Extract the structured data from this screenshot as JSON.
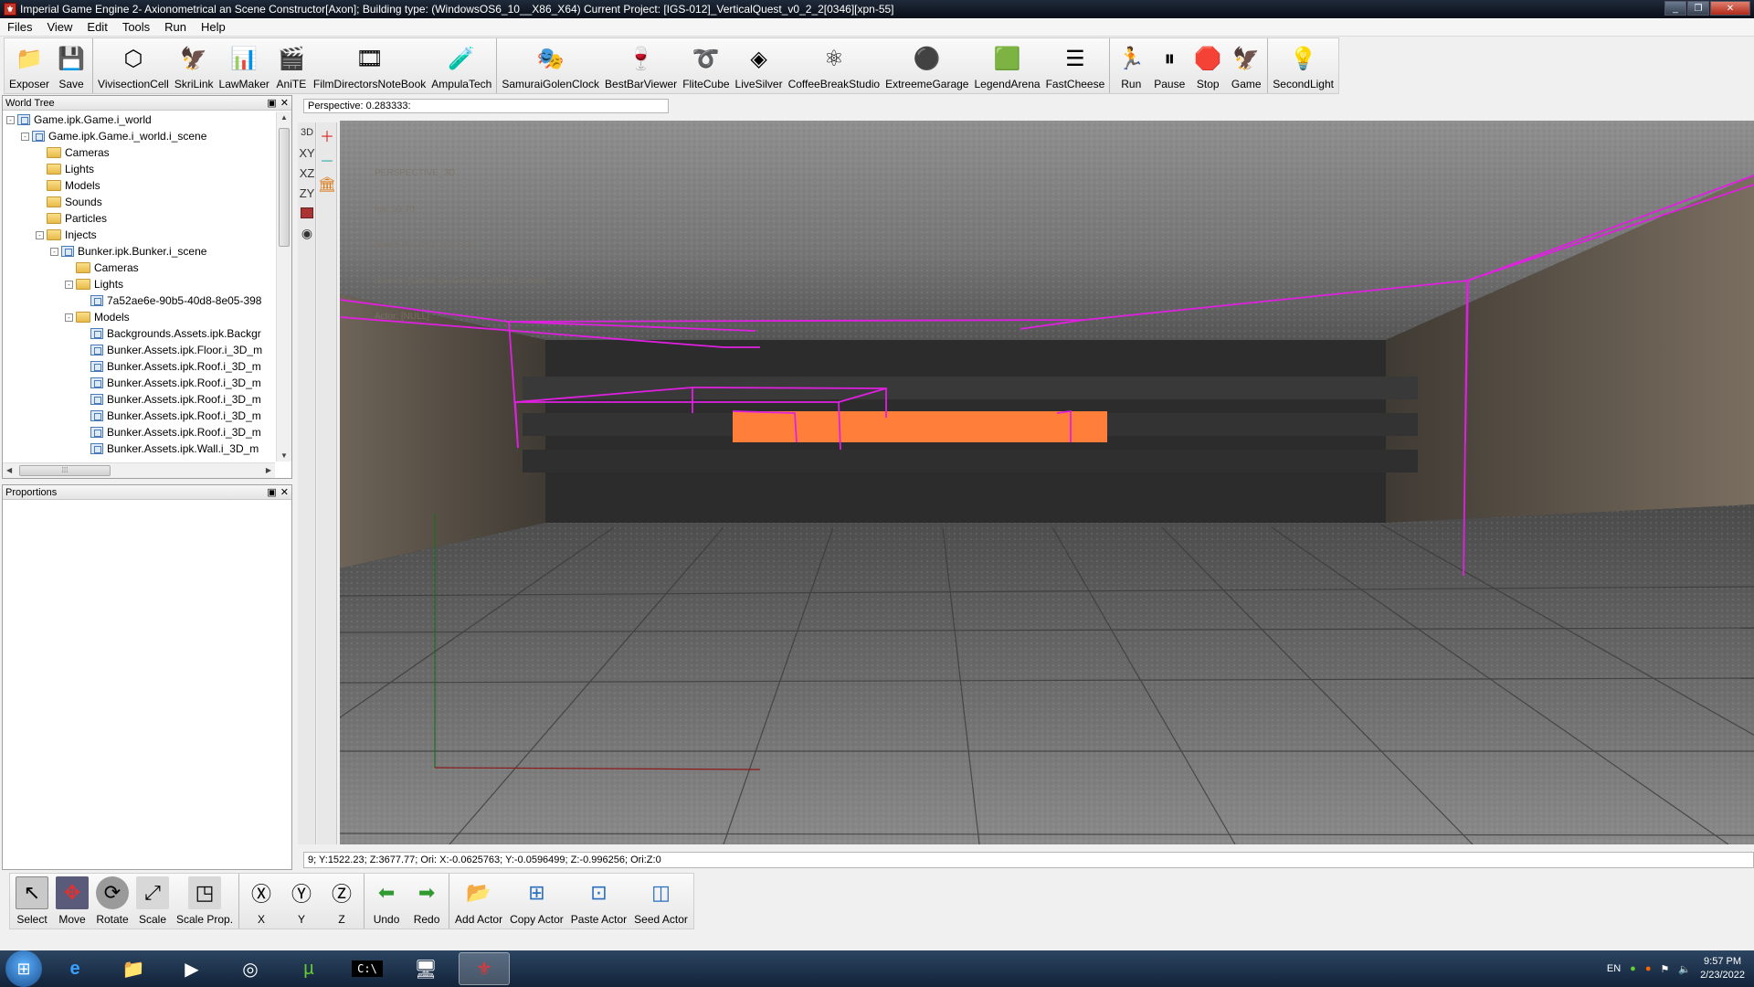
{
  "window": {
    "title": "Imperial Game Engine 2- Axionometrical an Scene Constructor[Axon]; Building type: (WindowsOS6_10__X86_X64) Current Project: [IGS-012]_VerticalQuest_v0_2_2[0346][xpn-55]",
    "buttons": [
      "_",
      "❐",
      "✕"
    ]
  },
  "menu": [
    "Files",
    "View",
    "Edit",
    "Tools",
    "Run",
    "Help"
  ],
  "toolbar": [
    {
      "label": "Exposer",
      "icon": "exposer-icon",
      "glyph": "📁"
    },
    {
      "label": "Save",
      "icon": "save-icon",
      "glyph": "💾"
    },
    {
      "label": "VivisectionCell",
      "icon": "cube-icon",
      "glyph": "⬡"
    },
    {
      "label": "SkriLink",
      "icon": "eagle-icon",
      "glyph": "🦅"
    },
    {
      "label": "LawMaker",
      "icon": "chart-icon",
      "glyph": "📊"
    },
    {
      "label": "AniTE",
      "icon": "clapper-icon",
      "glyph": "🎬"
    },
    {
      "label": "FilmDirectorsNoteBook",
      "icon": "notebook-icon",
      "glyph": "🎞"
    },
    {
      "label": "AmpulaTech",
      "icon": "ampule-icon",
      "glyph": "🧪"
    },
    {
      "label": "SamuraiGolenClock",
      "icon": "masks-icon",
      "glyph": "🎭"
    },
    {
      "label": "BestBarViewer",
      "icon": "bar-icon",
      "glyph": "🍷"
    },
    {
      "label": "FliteCube",
      "icon": "loop-icon",
      "glyph": "➰"
    },
    {
      "label": "LiveSilver",
      "icon": "diamond-icon",
      "glyph": "◈"
    },
    {
      "label": "CoffeeBreakStudio",
      "icon": "atom-icon",
      "glyph": "⚛"
    },
    {
      "label": "ExtreemeGarage",
      "icon": "dots-icon",
      "glyph": "⚫"
    },
    {
      "label": "LegendArena",
      "icon": "arena-icon",
      "glyph": "🟩"
    },
    {
      "label": "FastCheese",
      "icon": "sliders-icon",
      "glyph": "☰"
    },
    {
      "label": "Run",
      "icon": "run-icon",
      "glyph": "🏃"
    },
    {
      "label": "Pause",
      "icon": "pause-icon",
      "glyph": "⏸"
    },
    {
      "label": "Stop",
      "icon": "stop-icon",
      "glyph": "🛑"
    },
    {
      "label": "Game",
      "icon": "game-icon",
      "glyph": "🦅"
    },
    {
      "label": "SecondLight",
      "icon": "light-icon",
      "glyph": "💡"
    }
  ],
  "world_tree": {
    "title": "World Tree",
    "items": [
      {
        "label": "Game.ipk.Game.i_world",
        "indent": 0,
        "type": "node",
        "exp": "-"
      },
      {
        "label": "Game.ipk.Game.i_world.i_scene",
        "indent": 1,
        "type": "node",
        "exp": "-"
      },
      {
        "label": "Cameras",
        "indent": 2,
        "type": "folder",
        "exp": ""
      },
      {
        "label": "Lights",
        "indent": 2,
        "type": "folder",
        "exp": ""
      },
      {
        "label": "Models",
        "indent": 2,
        "type": "folder",
        "exp": ""
      },
      {
        "label": "Sounds",
        "indent": 2,
        "type": "folder",
        "exp": ""
      },
      {
        "label": "Particles",
        "indent": 2,
        "type": "folder",
        "exp": ""
      },
      {
        "label": "Injects",
        "indent": 2,
        "type": "folder",
        "exp": "-"
      },
      {
        "label": "Bunker.ipk.Bunker.i_scene",
        "indent": 3,
        "type": "node",
        "exp": "-"
      },
      {
        "label": "Cameras",
        "indent": 4,
        "type": "folder",
        "exp": ""
      },
      {
        "label": "Lights",
        "indent": 4,
        "type": "folder",
        "exp": "-"
      },
      {
        "label": "7a52ae6e-90b5-40d8-8e05-398",
        "indent": 5,
        "type": "node",
        "exp": ""
      },
      {
        "label": "Models",
        "indent": 4,
        "type": "folder",
        "exp": "-"
      },
      {
        "label": "Backgrounds.Assets.ipk.Backgr",
        "indent": 5,
        "type": "node",
        "exp": ""
      },
      {
        "label": "Bunker.Assets.ipk.Floor.i_3D_m",
        "indent": 5,
        "type": "node",
        "exp": ""
      },
      {
        "label": "Bunker.Assets.ipk.Roof.i_3D_m",
        "indent": 5,
        "type": "node",
        "exp": ""
      },
      {
        "label": "Bunker.Assets.ipk.Roof.i_3D_m",
        "indent": 5,
        "type": "node",
        "exp": ""
      },
      {
        "label": "Bunker.Assets.ipk.Roof.i_3D_m",
        "indent": 5,
        "type": "node",
        "exp": ""
      },
      {
        "label": "Bunker.Assets.ipk.Roof.i_3D_m",
        "indent": 5,
        "type": "node",
        "exp": ""
      },
      {
        "label": "Bunker.Assets.ipk.Roof.i_3D_m",
        "indent": 5,
        "type": "node",
        "exp": ""
      },
      {
        "label": "Bunker.Assets.ipk.Wall.i_3D_m",
        "indent": 5,
        "type": "node",
        "exp": ""
      }
    ]
  },
  "proportions": {
    "title": "Proportions"
  },
  "viewport": {
    "perspective_label": "Perspective: 0.283333:",
    "overlay": [
      "PERSPECTIVE_3D",
      "fps: 59.70",
      "Arena Pos: x[0] y[0] z[0]",
      "IScene: [Game.ipk.Game.i_world.i_scene]",
      "Actor: [NULL]"
    ],
    "status": "9; Y:1522.23; Z:3677.77; Ori: X:-0.0625763; Y:-0.0596499; Z:-0.996256; Ori:Z:0"
  },
  "view_modes": [
    "3D",
    "XY",
    "XZ",
    "ZY"
  ],
  "bottom_toolbar": [
    {
      "label": "Select",
      "icon": "select-icon",
      "glyph": "↖"
    },
    {
      "label": "Move",
      "icon": "move-icon",
      "glyph": "✥"
    },
    {
      "label": "Rotate",
      "icon": "rotate-icon",
      "glyph": "⟳"
    },
    {
      "label": "Scale",
      "icon": "scale-icon",
      "glyph": "⤢"
    },
    {
      "label": "Scale Prop.",
      "icon": "scale-prop-icon",
      "glyph": "◳"
    },
    {
      "label": "X",
      "icon": "axis-x-icon",
      "glyph": "Ⓧ"
    },
    {
      "label": "Y",
      "icon": "axis-y-icon",
      "glyph": "Ⓨ"
    },
    {
      "label": "Z",
      "icon": "axis-z-icon",
      "glyph": "Ⓩ"
    },
    {
      "label": "Undo",
      "icon": "undo-icon",
      "glyph": "⬅"
    },
    {
      "label": "Redo",
      "icon": "redo-icon",
      "glyph": "➡"
    },
    {
      "label": "Add Actor",
      "icon": "add-actor-icon",
      "glyph": "📂"
    },
    {
      "label": "Copy Actor",
      "icon": "copy-actor-icon",
      "glyph": "⊞"
    },
    {
      "label": "Paste Actor",
      "icon": "paste-actor-icon",
      "glyph": "⊡"
    },
    {
      "label": "Seed Actor",
      "icon": "seed-actor-icon",
      "glyph": "◫"
    }
  ],
  "taskbar": {
    "apps": [
      "ie-icon",
      "explorer-icon",
      "media-icon",
      "chrome-icon",
      "torrent-icon",
      "cmd-icon",
      "editor-icon",
      "engine-icon"
    ],
    "language": "EN",
    "time": "9:57 PM",
    "date": "2/23/2022"
  },
  "colors": {
    "wireframe": "#e020e0",
    "highlight": "#ff7f3a"
  }
}
